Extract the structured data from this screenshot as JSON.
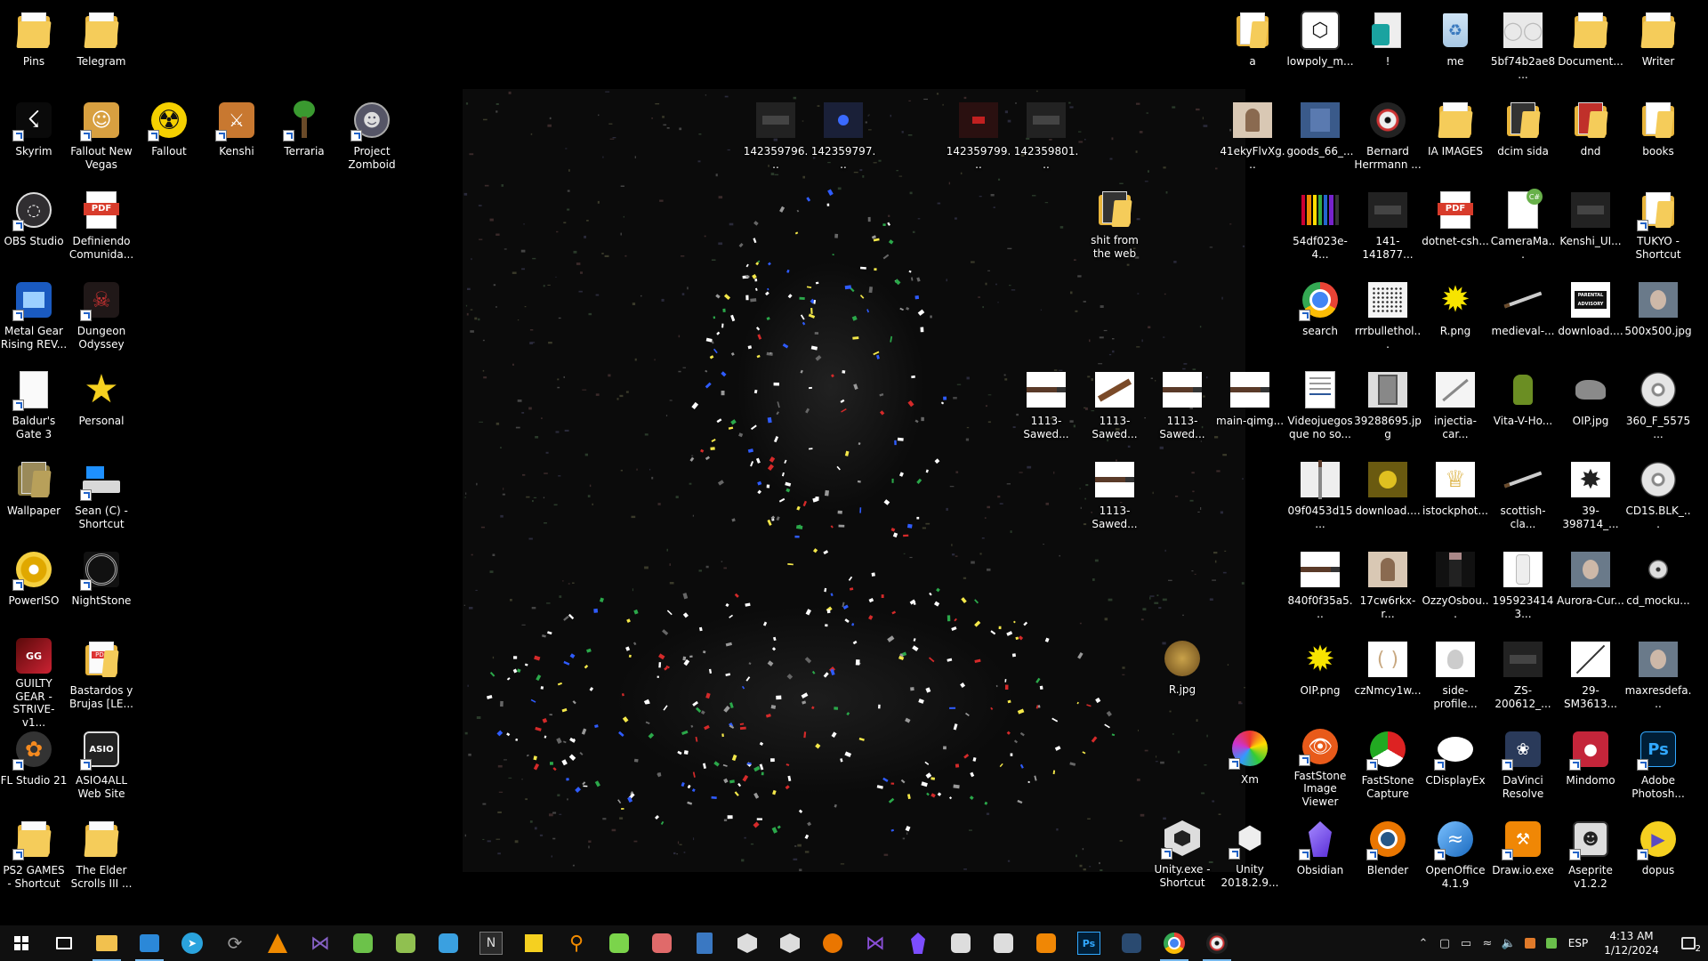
{
  "desktop": {
    "icons": [
      {
        "label": "Pins",
        "kind": "folder",
        "shortcut": false,
        "col": 0,
        "row": 0,
        "side": "L"
      },
      {
        "label": "Telegram",
        "kind": "folder",
        "shortcut": false,
        "col": 1,
        "row": 0,
        "side": "L"
      },
      {
        "label": "Skyrim",
        "kind": "game-skyrim",
        "shortcut": true,
        "col": 0,
        "row": 1,
        "side": "L"
      },
      {
        "label": "Fallout New Vegas",
        "kind": "game-fnv",
        "shortcut": true,
        "col": 1,
        "row": 1,
        "side": "L"
      },
      {
        "label": "Fallout",
        "kind": "game-fallout",
        "shortcut": true,
        "col": 2,
        "row": 1,
        "side": "L"
      },
      {
        "label": "Kenshi",
        "kind": "game-kenshi",
        "shortcut": true,
        "col": 3,
        "row": 1,
        "side": "L"
      },
      {
        "label": "Terraria",
        "kind": "game-terraria",
        "shortcut": true,
        "col": 4,
        "row": 1,
        "side": "L"
      },
      {
        "label": "Project Zomboid",
        "kind": "game-zomboid",
        "shortcut": true,
        "col": 5,
        "row": 1,
        "side": "L"
      },
      {
        "label": "OBS Studio",
        "kind": "app-obs",
        "shortcut": true,
        "col": 0,
        "row": 2,
        "side": "L"
      },
      {
        "label": "Definiendo Comunida...",
        "kind": "pdf",
        "shortcut": false,
        "col": 1,
        "row": 2,
        "side": "L"
      },
      {
        "label": "Metal Gear Rising REV...",
        "kind": "game-mgr",
        "shortcut": true,
        "col": 0,
        "row": 3,
        "side": "L"
      },
      {
        "label": "Dungeon Odyssey",
        "kind": "game-dungeon",
        "shortcut": true,
        "col": 1,
        "row": 3,
        "side": "L"
      },
      {
        "label": "Baldur's Gate 3",
        "kind": "file-white",
        "shortcut": true,
        "col": 0,
        "row": 4,
        "side": "L"
      },
      {
        "label": "Personal",
        "kind": "star",
        "shortcut": false,
        "col": 1,
        "row": 4,
        "side": "L"
      },
      {
        "label": "Wallpaper",
        "kind": "folder-img",
        "shortcut": false,
        "col": 0,
        "row": 5,
        "side": "L"
      },
      {
        "label": "Sean (C) - Shortcut",
        "kind": "drive",
        "shortcut": true,
        "col": 1,
        "row": 5,
        "side": "L"
      },
      {
        "label": "PowerISO",
        "kind": "app-poweriso",
        "shortcut": true,
        "col": 0,
        "row": 6,
        "side": "L"
      },
      {
        "label": "NightStone",
        "kind": "app-nightstone",
        "shortcut": true,
        "col": 1,
        "row": 6,
        "side": "L"
      },
      {
        "label": "GUILTY GEAR -STRIVE- v1...",
        "kind": "game-gg",
        "shortcut": false,
        "col": 0,
        "row": 7,
        "side": "L"
      },
      {
        "label": "Bastardos y Brujas [LE...",
        "kind": "folder-pdf",
        "shortcut": false,
        "col": 1,
        "row": 7,
        "side": "L"
      },
      {
        "label": "FL Studio 21",
        "kind": "app-fl",
        "shortcut": true,
        "col": 0,
        "row": 8,
        "side": "L"
      },
      {
        "label": "ASIO4ALL Web Site",
        "kind": "app-asio",
        "shortcut": true,
        "col": 1,
        "row": 8,
        "side": "L"
      },
      {
        "label": "PS2 GAMES - Shortcut",
        "kind": "folder",
        "shortcut": true,
        "col": 0,
        "row": 9,
        "side": "L"
      },
      {
        "label": "The Elder Scrolls III ...",
        "kind": "folder",
        "shortcut": false,
        "col": 1,
        "row": 9,
        "side": "L"
      },
      {
        "label": "a",
        "kind": "folder-doc",
        "shortcut": false,
        "col": 0,
        "row": 0,
        "side": "R"
      },
      {
        "label": "lowpoly_m...",
        "kind": "box3d",
        "shortcut": false,
        "col": 1,
        "row": 0,
        "side": "R"
      },
      {
        "label": "!",
        "kind": "file-green",
        "shortcut": false,
        "col": 2,
        "row": 0,
        "side": "R"
      },
      {
        "label": "me",
        "kind": "recycle",
        "shortcut": false,
        "col": 3,
        "row": 0,
        "side": "R"
      },
      {
        "label": "5bf74b2ae8...",
        "kind": "img-bottles",
        "shortcut": false,
        "col": 4,
        "row": 0,
        "side": "R"
      },
      {
        "label": "Document...",
        "kind": "folder",
        "shortcut": false,
        "col": 5,
        "row": 0,
        "side": "R"
      },
      {
        "label": "Writer",
        "kind": "folder",
        "shortcut": false,
        "col": 6,
        "row": 0,
        "side": "R"
      },
      {
        "label": "41ekyFlvXg...",
        "kind": "img-person",
        "shortcut": false,
        "col": 0,
        "row": 1,
        "side": "R"
      },
      {
        "label": "goods_66_...",
        "kind": "img-shirt",
        "shortcut": false,
        "col": 1,
        "row": 1,
        "side": "R"
      },
      {
        "label": "Bernard Herrmann ...",
        "kind": "vinyl",
        "shortcut": false,
        "col": 2,
        "row": 1,
        "side": "R"
      },
      {
        "label": "IA IMAGES",
        "kind": "folder",
        "shortcut": false,
        "col": 3,
        "row": 1,
        "side": "R"
      },
      {
        "label": "dcim sida",
        "kind": "folder-dark",
        "shortcut": false,
        "col": 4,
        "row": 1,
        "side": "R"
      },
      {
        "label": "dnd",
        "kind": "folder-red",
        "shortcut": false,
        "col": 5,
        "row": 1,
        "side": "R"
      },
      {
        "label": "books",
        "kind": "folder-doc",
        "shortcut": false,
        "col": 6,
        "row": 1,
        "side": "R"
      },
      {
        "label": "54df023e-4...",
        "kind": "img-colors",
        "shortcut": false,
        "col": 0,
        "row": 2,
        "side": "R"
      },
      {
        "label": "141-141877...",
        "kind": "img-dark",
        "shortcut": false,
        "col": 1,
        "row": 2,
        "side": "R"
      },
      {
        "label": "dotnet-csh...",
        "kind": "pdf",
        "shortcut": false,
        "col": 2,
        "row": 2,
        "side": "R"
      },
      {
        "label": "CameraMa...",
        "kind": "file-cs",
        "shortcut": false,
        "col": 3,
        "row": 2,
        "side": "R"
      },
      {
        "label": "Kenshi_UI...",
        "kind": "img-dark",
        "shortcut": false,
        "col": 4,
        "row": 2,
        "side": "R"
      },
      {
        "label": "TUKYO - Shortcut",
        "kind": "folder-doc",
        "shortcut": true,
        "col": 5,
        "row": 2,
        "side": "R"
      },
      {
        "label": "search",
        "kind": "chrome",
        "shortcut": true,
        "col": 0,
        "row": 3,
        "side": "R"
      },
      {
        "label": "rrrbullethol...",
        "kind": "img-dots",
        "shortcut": false,
        "col": 1,
        "row": 3,
        "side": "R"
      },
      {
        "label": "R.png",
        "kind": "star-burst",
        "shortcut": false,
        "col": 2,
        "row": 3,
        "side": "R"
      },
      {
        "label": "medieval-...",
        "kind": "img-sword",
        "shortcut": false,
        "col": 3,
        "row": 3,
        "side": "R"
      },
      {
        "label": "download....",
        "kind": "img-advisory",
        "shortcut": false,
        "col": 4,
        "row": 3,
        "side": "R"
      },
      {
        "label": "500x500.jpg",
        "kind": "img-face",
        "shortcut": false,
        "col": 5,
        "row": 3,
        "side": "R"
      },
      {
        "label": "Videojuegos que no so...",
        "kind": "file-doc",
        "shortcut": false,
        "col": 0,
        "row": 4,
        "side": "R"
      },
      {
        "label": "39288695.jpg",
        "kind": "img-can",
        "shortcut": false,
        "col": 1,
        "row": 4,
        "side": "R"
      },
      {
        "label": "injectia-car...",
        "kind": "img-syringe",
        "shortcut": false,
        "col": 2,
        "row": 4,
        "side": "R"
      },
      {
        "label": "Vita-V-Ho...",
        "kind": "img-bottle-green",
        "shortcut": false,
        "col": 3,
        "row": 4,
        "side": "R"
      },
      {
        "label": "OIP.jpg",
        "kind": "img-rock",
        "shortcut": false,
        "col": 4,
        "row": 4,
        "side": "R"
      },
      {
        "label": "360_F_5575...",
        "kind": "disc",
        "shortcut": false,
        "col": 5,
        "row": 4,
        "side": "R"
      },
      {
        "label": "09f0453d15...",
        "kind": "img-sword-v",
        "shortcut": false,
        "col": 0,
        "row": 5,
        "side": "R"
      },
      {
        "label": "download....",
        "kind": "img-yellow",
        "shortcut": false,
        "col": 1,
        "row": 5,
        "side": "R"
      },
      {
        "label": "istockphot...",
        "kind": "img-crown",
        "shortcut": false,
        "col": 2,
        "row": 5,
        "side": "R"
      },
      {
        "label": "scottish-cla...",
        "kind": "img-sword",
        "shortcut": false,
        "col": 3,
        "row": 5,
        "side": "R"
      },
      {
        "label": "39-398714_...",
        "kind": "img-starwhite",
        "shortcut": false,
        "col": 4,
        "row": 5,
        "side": "R"
      },
      {
        "label": "CD1S.BLK_...",
        "kind": "disc",
        "shortcut": false,
        "col": 5,
        "row": 5,
        "side": "R"
      },
      {
        "label": "840f0f35a5...",
        "kind": "img-gun",
        "shortcut": false,
        "col": 0,
        "row": 6,
        "side": "R"
      },
      {
        "label": "17cw6rkx-r...",
        "kind": "img-person",
        "shortcut": false,
        "col": 1,
        "row": 6,
        "side": "R"
      },
      {
        "label": "OzzyOsbou...",
        "kind": "img-ozzy",
        "shortcut": false,
        "col": 2,
        "row": 6,
        "side": "R"
      },
      {
        "label": "1959234143...",
        "kind": "img-bottle-white",
        "shortcut": false,
        "col": 3,
        "row": 6,
        "side": "R"
      },
      {
        "label": "Aurora-Cur...",
        "kind": "img-face",
        "shortcut": false,
        "col": 4,
        "row": 6,
        "side": "R"
      },
      {
        "label": "cd_mocku...",
        "kind": "disc-small",
        "shortcut": false,
        "col": 5,
        "row": 6,
        "side": "R"
      },
      {
        "label": "OIP.png",
        "kind": "star-burst",
        "shortcut": false,
        "col": 0,
        "row": 7,
        "side": "R"
      },
      {
        "label": "czNmcy1w...",
        "kind": "img-horns",
        "shortcut": false,
        "col": 1,
        "row": 7,
        "side": "R"
      },
      {
        "label": "side-profile...",
        "kind": "img-skull",
        "shortcut": false,
        "col": 2,
        "row": 7,
        "side": "R"
      },
      {
        "label": "ZS-200612_...",
        "kind": "img-dark",
        "shortcut": false,
        "col": 3,
        "row": 7,
        "side": "R"
      },
      {
        "label": "29-SM3613...",
        "kind": "img-spear",
        "shortcut": false,
        "col": 4,
        "row": 7,
        "side": "R"
      },
      {
        "label": "maxresdefa...",
        "kind": "img-face",
        "shortcut": false,
        "col": 5,
        "row": 7,
        "side": "R"
      },
      {
        "label": "FastStone Image Viewer",
        "kind": "app-fsviewer",
        "shortcut": true,
        "col": 0,
        "row": 8,
        "side": "R"
      },
      {
        "label": "FastStone Capture",
        "kind": "app-fscapture",
        "shortcut": true,
        "col": 1,
        "row": 8,
        "side": "R"
      },
      {
        "label": "CDisplayEx",
        "kind": "app-cdisplay",
        "shortcut": true,
        "col": 2,
        "row": 8,
        "side": "R"
      },
      {
        "label": "DaVinci Resolve",
        "kind": "app-davinci",
        "shortcut": true,
        "col": 3,
        "row": 8,
        "side": "R"
      },
      {
        "label": "Mindomo",
        "kind": "app-mindomo",
        "shortcut": true,
        "col": 4,
        "row": 8,
        "side": "R"
      },
      {
        "label": "Adobe Photosh...",
        "kind": "app-ps",
        "shortcut": true,
        "col": 5,
        "row": 8,
        "side": "R"
      },
      {
        "label": "Obsidian",
        "kind": "app-obsidian",
        "shortcut": true,
        "col": 0,
        "row": 9,
        "side": "R"
      },
      {
        "label": "Blender",
        "kind": "app-blender",
        "shortcut": true,
        "col": 1,
        "row": 9,
        "side": "R"
      },
      {
        "label": "OpenOffice 4.1.9",
        "kind": "app-openoffice",
        "shortcut": true,
        "col": 2,
        "row": 9,
        "side": "R"
      },
      {
        "label": "Draw.io.exe",
        "kind": "app-drawio",
        "shortcut": true,
        "col": 3,
        "row": 9,
        "side": "R"
      },
      {
        "label": "Aseprite v1.2.2",
        "kind": "app-aseprite",
        "shortcut": true,
        "col": 4,
        "row": 9,
        "side": "R"
      },
      {
        "label": "dopus",
        "kind": "app-dopus",
        "shortcut": true,
        "col": 5,
        "row": 9,
        "side": "R"
      }
    ],
    "free_icons": [
      {
        "label": "142359796...",
        "kind": "img-dark",
        "slot": "w1"
      },
      {
        "label": "142359797...",
        "kind": "img-blue",
        "slot": "w2"
      },
      {
        "label": "142359799...",
        "kind": "img-red",
        "slot": "w3"
      },
      {
        "label": "142359801...",
        "kind": "img-dark",
        "slot": "w4"
      },
      {
        "label": "shit from the web",
        "kind": "folder-dark",
        "slot": "w5"
      },
      {
        "label": "1113-Sawed...",
        "kind": "img-gun",
        "slot": "w6"
      },
      {
        "label": "1113-Sawed...",
        "kind": "img-gun-big",
        "slot": "w7"
      },
      {
        "label": "1113-Sawed...",
        "kind": "img-gun",
        "slot": "w8"
      },
      {
        "label": "main-qimg...",
        "kind": "img-gun",
        "slot": "w9"
      },
      {
        "label": "1113-Sawed...",
        "kind": "img-gun",
        "slot": "w10"
      },
      {
        "label": "R.jpg",
        "kind": "img-coin",
        "slot": "w11"
      },
      {
        "label": "Xm",
        "kind": "app-xm",
        "slot": "w12",
        "shortcut": true
      },
      {
        "label": "Unity.exe - Shortcut",
        "kind": "app-unityhub",
        "slot": "w13",
        "shortcut": true
      },
      {
        "label": "Unity 2018.2.9...",
        "kind": "app-unity",
        "slot": "w14",
        "shortcut": true
      }
    ]
  },
  "taskbar": {
    "buttons": [
      {
        "name": "start-button",
        "label": "",
        "color": "#ffffff",
        "kind": "win"
      },
      {
        "name": "task-view-button",
        "label": "",
        "color": "#ffffff",
        "kind": "taskview"
      },
      {
        "name": "taskbar-file-explorer",
        "label": "",
        "color": "#f2c14e",
        "kind": "folder",
        "open": true
      },
      {
        "name": "taskbar-store",
        "label": "",
        "color": "#2b88d8",
        "kind": "store",
        "open": true
      },
      {
        "name": "taskbar-telegram",
        "label": "",
        "color": "#2aa3dd",
        "kind": "telegram"
      },
      {
        "name": "taskbar-sync",
        "label": "",
        "color": "#9a9a9a",
        "kind": "sync"
      },
      {
        "name": "taskbar-vlc",
        "label": "",
        "color": "#f08a00",
        "kind": "vlc"
      },
      {
        "name": "taskbar-visual-studio",
        "label": "",
        "color": "#8661c5",
        "kind": "vs"
      },
      {
        "name": "taskbar-app-globe",
        "label": "",
        "color": "#6cc24a",
        "kind": "globe"
      },
      {
        "name": "taskbar-notepadpp",
        "label": "",
        "color": "#90c050",
        "kind": "notepad"
      },
      {
        "name": "taskbar-earth",
        "label": "",
        "color": "#3aa0e0",
        "kind": "earth"
      },
      {
        "name": "taskbar-notion",
        "label": "N",
        "color": "#2a2a2a",
        "kind": "text"
      },
      {
        "name": "taskbar-sticky-notes",
        "label": "",
        "color": "#f5d020",
        "kind": "sticky"
      },
      {
        "name": "taskbar-search-app",
        "label": "",
        "color": "#f08a00",
        "kind": "magnifier"
      },
      {
        "name": "taskbar-app-3d",
        "label": "",
        "color": "#7bd44b",
        "kind": "circle3d"
      },
      {
        "name": "taskbar-app-brain",
        "label": "",
        "color": "#e06a6a",
        "kind": "brain"
      },
      {
        "name": "taskbar-calculator",
        "label": "",
        "color": "#3a78c2",
        "kind": "calc"
      },
      {
        "name": "taskbar-unity-hub",
        "label": "",
        "color": "#dddddd",
        "kind": "cube"
      },
      {
        "name": "taskbar-unity",
        "label": "",
        "color": "#dddddd",
        "kind": "cube2"
      },
      {
        "name": "taskbar-blender",
        "label": "",
        "color": "#ea7600",
        "kind": "blender"
      },
      {
        "name": "taskbar-vscode",
        "label": "",
        "color": "#8a4fd8",
        "kind": "vs"
      },
      {
        "name": "taskbar-obsidian",
        "label": "",
        "color": "#7c4dff",
        "kind": "obsidian"
      },
      {
        "name": "taskbar-aseprite",
        "label": "",
        "color": "#dddddd",
        "kind": "aseprite"
      },
      {
        "name": "taskbar-app-book",
        "label": "",
        "color": "#dddddd",
        "kind": "book"
      },
      {
        "name": "taskbar-drawio",
        "label": "",
        "color": "#f08705",
        "kind": "drawio"
      },
      {
        "name": "taskbar-photoshop",
        "label": "Ps",
        "color": "#001e36",
        "kind": "ps"
      },
      {
        "name": "taskbar-davinci",
        "label": "",
        "color": "#2a4a70",
        "kind": "davinci"
      },
      {
        "name": "taskbar-chrome",
        "label": "",
        "color": "#4285f4",
        "kind": "chrome",
        "open": true
      },
      {
        "name": "taskbar-media",
        "label": "",
        "color": "#d0d0d0",
        "kind": "vinyl",
        "open": true
      }
    ],
    "tray": {
      "language": "ESP",
      "time": "4:13 AM",
      "date": "1/12/2024",
      "notification_count": "2"
    }
  }
}
